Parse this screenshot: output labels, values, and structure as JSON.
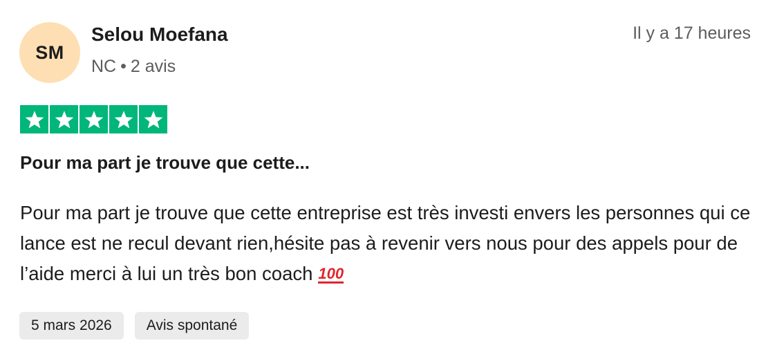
{
  "reviewer": {
    "initials": "SM",
    "name": "Selou Moefana",
    "country": "NC",
    "separator": "•",
    "review_count": "2 avis",
    "avatar_color": "#fddfb3"
  },
  "time_ago": "Il y a 17 heures",
  "rating": {
    "stars": 5,
    "max_stars": 5,
    "star_color": "#00b67a"
  },
  "review": {
    "title": "Pour ma part je trouve que cette...",
    "body": "Pour ma part je trouve que cette entreprise est très investi envers les personnes qui ce lance est ne recul devant rien,hésite pas à revenir vers nous pour des appels pour de l’aide merci à lui un très bon coach",
    "emoji": "💯",
    "emoji_glyph": "100"
  },
  "tags": {
    "date": "5 mars 2026",
    "type": "Avis spontané"
  }
}
